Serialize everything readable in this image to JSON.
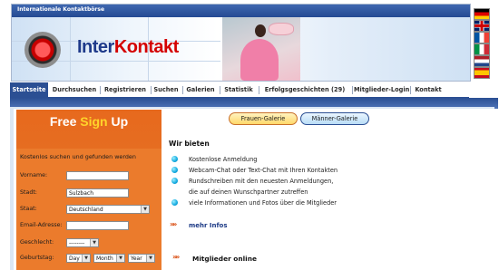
{
  "header": {
    "site_name": "Internationale Kontaktbörse",
    "logo_part1": "Inter",
    "logo_part2": "Kontakt"
  },
  "languages": [
    "german-flag",
    "english-flag",
    "french-flag",
    "italian-flag",
    "dutch-flag",
    "spanish-flag"
  ],
  "nav": {
    "items": [
      {
        "label": "Startseite",
        "active": true
      },
      {
        "label": "Durchsuchen"
      },
      {
        "label": "Registrieren"
      },
      {
        "label": "Suchen"
      },
      {
        "label": "Galerien"
      },
      {
        "label": "Statistik"
      },
      {
        "label": "Erfolgsgeschichten (29)"
      },
      {
        "label": "Mitglieder-Login"
      },
      {
        "label": "Kontakt"
      }
    ]
  },
  "signup": {
    "title_free": "Free",
    "title_sign": "Sign",
    "title_up": "Up",
    "heading": "Kostenlos suchen und gefunden werden",
    "fields": {
      "vorname": {
        "label": "Vorname:",
        "value": ""
      },
      "stadt": {
        "label": "Stadt:",
        "value": "Sulzbach"
      },
      "staat": {
        "label": "Staat:",
        "value": "Deutschland"
      },
      "email": {
        "label": "Email-Adresse:",
        "value": ""
      },
      "geschlecht": {
        "label": "Geschlecht:",
        "value": "--------"
      },
      "geburtstag": {
        "label": "Geburtstag:",
        "day": "Day",
        "month": "Month",
        "year": "Year"
      }
    }
  },
  "gallery": {
    "frauen": "Frauen-Galerie",
    "maenner": "Männer-Galerie"
  },
  "wir_bieten": {
    "title": "Wir bieten",
    "items": [
      "Kostenlose Anmeldung",
      "Webcam-Chat oder Text-Chat mit Ihren Kontakten",
      "Rundschreiben mit den neuesten Anmeldungen,",
      "die auf deinen Wunschpartner zutreffen",
      "viele Informationen und Fotos über die Mitglieder"
    ],
    "more": "mehr Infos"
  },
  "members_online": "Mitglieder online",
  "colors": {
    "nav_active": "#2b4f93",
    "signup_orange": "#eb7b2c",
    "accent_yellow": "#ffd42a",
    "link_blue": "#1d3a86"
  }
}
